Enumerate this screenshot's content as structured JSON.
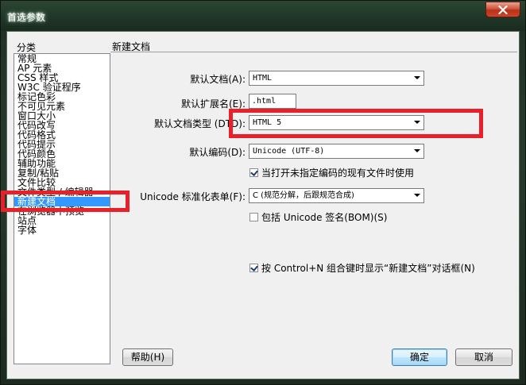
{
  "window": {
    "title": "首选参数"
  },
  "categories": {
    "header": "分类",
    "items": [
      "常规",
      "AP 元素",
      "CSS 样式",
      "W3C 验证程序",
      "标记色彩",
      "不可见元素",
      "窗口大小",
      "代码改写",
      "代码格式",
      "代码提示",
      "代码颜色",
      "辅助功能",
      "复制/粘贴",
      "文件比较",
      "文件类型 / 编辑器",
      "新建文档",
      "在浏览器中预览",
      "站点",
      "字体"
    ],
    "selected_index": 15
  },
  "section": {
    "title": "新建文档"
  },
  "form": {
    "default_doc_label": "默认文档(A):",
    "default_doc_value": "HTML",
    "default_ext_label": "默认扩展名(E):",
    "default_ext_value": ".html",
    "doctype_label": "默认文档类型 (DTD):",
    "doctype_value": "HTML 5",
    "encoding_label": "默认编码(D):",
    "encoding_value": "Unicode (UTF-8)",
    "open_unspecified_label": "当打开未指定编码的现有文件时使用",
    "open_unspecified_checked": true,
    "normalize_label": "Unicode 标准化表单(F):",
    "normalize_value": "C (规范分解，后跟规范合成)",
    "bom_label": "包括 Unicode 签名(BOM)(S)",
    "bom_checked": false,
    "ctrl_n_label": "按 Control+N 组合键时显示“新建文档”对话框(N)",
    "ctrl_n_checked": true
  },
  "buttons": {
    "help": "帮助(H)",
    "ok": "确定",
    "cancel": "取消"
  },
  "colors": {
    "selection": "#3399ff",
    "annotation": "#e8202a"
  }
}
